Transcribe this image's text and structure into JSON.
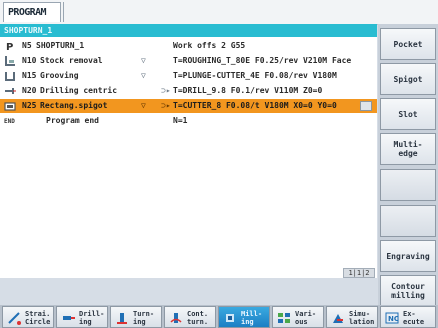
{
  "header": {
    "tab_label": "PROGRAM"
  },
  "program_name": "SHOPTURN_1",
  "rows": [
    {
      "icon": "p-letter-icon",
      "num": "P",
      "name": "N5",
      "label": "SHOPTURN_1",
      "arrow": "",
      "arrow2": "",
      "detail": "Work offs 2 G55"
    },
    {
      "icon": "stock-removal-icon",
      "num": "",
      "name": "N10",
      "label": "Stock removal",
      "arrow": "▽",
      "arrow2": "",
      "detail": "T=ROUGHING_T_80E F0.25/rev V210M Face"
    },
    {
      "icon": "grooving-icon",
      "num": "",
      "name": "N15",
      "label": "Grooving",
      "arrow": "▽",
      "arrow2": "",
      "detail": "T=PLUNGE-CUTTER_4E F0.08/rev V180M"
    },
    {
      "icon": "drilling-icon",
      "num": "",
      "name": "N20",
      "label": "Drilling centric",
      "arrow": "",
      "arrow2": "⊃▸",
      "detail": "T=DRILL_9.8 F0.1/rev V110M Z0=0"
    },
    {
      "icon": "rect-spigot-icon",
      "num": "",
      "name": "N25",
      "label": "Rectang.spigot",
      "arrow": "▽",
      "arrow2": "⊃▸",
      "detail": "T=CUTTER_8 F0.08/t V180M X0=0 Y0=0"
    },
    {
      "icon": "end-icon",
      "num": "",
      "name": "",
      "label": "Program end",
      "arrow": "",
      "arrow2": "",
      "detail": "N=1"
    }
  ],
  "end_icon_text": "END",
  "page_indicator": "1|1|2",
  "vertical_softkeys": [
    "Pocket",
    "Spigot",
    "Slot",
    "Multi-\nedge",
    "",
    "",
    "Engraving",
    "Contour\nmilling"
  ],
  "horizontal_softkeys": [
    {
      "label": "Strai.\nCircle",
      "icon": "straight-circle-icon",
      "active": false
    },
    {
      "label": "Drill-\ning",
      "icon": "drilling-icon",
      "active": false
    },
    {
      "label": "Turn-\ning",
      "icon": "turning-icon",
      "active": false
    },
    {
      "label": "Cont.\nturn.",
      "icon": "contour-turning-icon",
      "active": false
    },
    {
      "label": "Mill-\ning",
      "icon": "milling-icon",
      "active": true
    },
    {
      "label": "Vari-\nous",
      "icon": "various-icon",
      "active": false
    },
    {
      "label": "Simu-\nlation",
      "icon": "simulation-icon",
      "active": false
    },
    {
      "label": "Ex-\necute",
      "icon": "execute-icon",
      "active": false
    }
  ],
  "colors": {
    "accent": "#29bcd1",
    "selected": "#f2961f",
    "active_softkey": "#1b7fc4"
  }
}
